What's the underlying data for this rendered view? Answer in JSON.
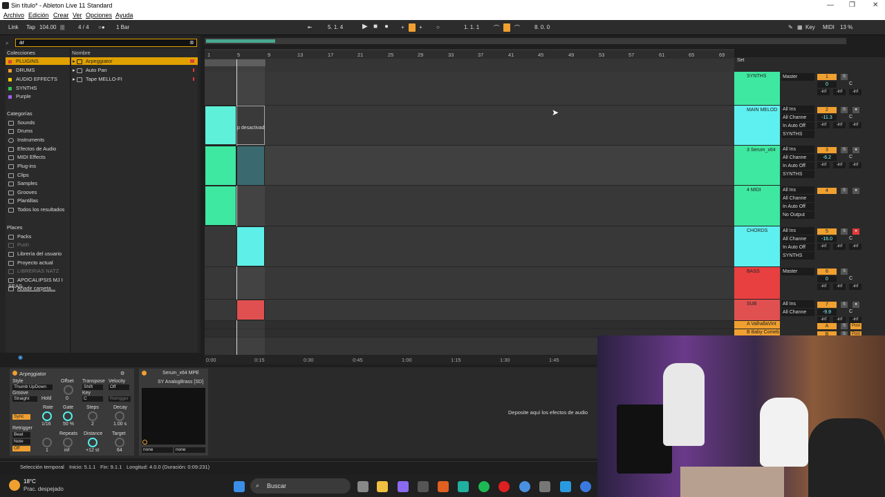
{
  "titlebar": {
    "title": "Sin título* - Ableton Live 11 Standard"
  },
  "menu": [
    "Archivo",
    "Edición",
    "Crear",
    "Ver",
    "Opciones",
    "Ayuda"
  ],
  "transport": {
    "link": "Link",
    "tap": "Tap",
    "tempo": "104.00",
    "signature": "4 / 4",
    "quantize": "1 Bar",
    "position": "5.  1.  4",
    "loop_start": "1.  1.  1",
    "loop_length": "8.  0.  0",
    "key": "Key",
    "midi": "MIDI",
    "cpu": "13 %"
  },
  "browser": {
    "search_value": "ar",
    "collections_header": "Colecciones",
    "collections": [
      {
        "label": "PLUGINS",
        "color": "#e23a3a"
      },
      {
        "label": "DRUMS",
        "color": "#f0a030"
      },
      {
        "label": "AUDIO EFFECTS",
        "color": "#f0d000"
      },
      {
        "label": "SYNTHS",
        "color": "#2ec850"
      },
      {
        "label": "Purple",
        "color": "#a060ff"
      }
    ],
    "categories_header": "Categorías",
    "categories": [
      "Sounds",
      "Drums",
      "Instruments",
      "Efectos de Audio",
      "MIDI Effects",
      "Plug-ins",
      "Clips",
      "Samples",
      "Grooves",
      "Plantillas",
      "Todos los resultados"
    ],
    "places_header": "Places",
    "places": [
      "Packs",
      "Push",
      "Librería del usuario",
      "Proyecto actual",
      "LIBRERIAS NATZ",
      "APOCALIPSIS MJ I SEAS",
      "Añadir carpeta..."
    ],
    "name_header": "Nombre",
    "results": [
      "Arpeggiator",
      "Auto Pan",
      "Tape MELLO-FI"
    ]
  },
  "ruler": [
    "1",
    "5",
    "9",
    "13",
    "17",
    "21",
    "25",
    "29",
    "33",
    "37",
    "41",
    "45",
    "49",
    "53",
    "57",
    "61",
    "65",
    "69"
  ],
  "clip_text": "p desactivad",
  "set_label": "Set",
  "tracks": [
    {
      "name": "SYNTHS",
      "color": "#3ee8a0",
      "num": "1",
      "io": [
        "Master"
      ],
      "vol": "0",
      "pan": "C"
    },
    {
      "name": "MAIN MELOD",
      "color": "#5ef0f0",
      "num": "2",
      "io": [
        "All Ins",
        "All Channe",
        "In  Auto  Off",
        "SYNTHS"
      ],
      "vol": "-11.3",
      "pan": "C"
    },
    {
      "name": "3 Serum_x64",
      "color": "#3ee8a0",
      "num": "3",
      "io": [
        "All Ins",
        "All Channe",
        "In  Auto  Off",
        "SYNTHS"
      ],
      "vol": "-6.2",
      "pan": "C"
    },
    {
      "name": "4 MIDI",
      "color": "#3ee8a0",
      "num": "4",
      "io": [
        "All Ins",
        "All Channe",
        "In  Auto  Off",
        "No Output"
      ],
      "vol": "",
      "pan": ""
    },
    {
      "name": "CHORDS",
      "color": "#5ef0f0",
      "num": "5",
      "io": [
        "All Ins",
        "All Channe",
        "In  Auto  Off",
        "SYNTHS"
      ],
      "vol": "-16.0",
      "pan": "C"
    },
    {
      "name": "BASS",
      "color": "#e84040",
      "num": "6",
      "io": [
        "Master"
      ],
      "vol": "0",
      "pan": "C"
    },
    {
      "name": "SUB",
      "color": "#e05050",
      "num": "7",
      "io": [
        "All Ins",
        "All Channe"
      ],
      "vol": "-9.9",
      "pan": "C"
    }
  ],
  "returns": [
    {
      "name": "A ValhallaVint",
      "num": "A",
      "post": "Post"
    },
    {
      "name": "B Baby Comeb",
      "num": "B",
      "post": "Post"
    }
  ],
  "inf": "-inf",
  "timeline": [
    "0:00",
    "0:15",
    "0:30",
    "0:45",
    "1:00",
    "1:15",
    "1:30",
    "1:45"
  ],
  "device": {
    "arp_title": "Arpeggiator",
    "style_label": "Style",
    "style_value": "Thumb UpDown",
    "groove_label": "Groove",
    "groove_value": "Straight",
    "hold": "Hold",
    "offset_label": "Offset",
    "offset_value": "0",
    "transpose_label": "Transpose",
    "transpose_value": "Shift",
    "key_label": "Key",
    "key_value": "C",
    "velocity_label": "Velocity",
    "velocity_value": "Off",
    "retrigger_btn": "Retrigger",
    "sync": "Sync",
    "rate_label": "Rate",
    "rate_value": "1/16",
    "gate_label": "Gate",
    "gate_value": "50 %",
    "steps_label": "Steps",
    "steps_value": "2",
    "decay_label": "Decay",
    "decay_value": "1.00 s",
    "retrigger_label": "Retrigger",
    "beat": "Beat",
    "note": "Note",
    "off": "Off",
    "retrig_knob_value": "1",
    "repeats_label": "Repeats",
    "repeats_value": "inf",
    "distance_label": "Distance",
    "distance_value": "+12 st",
    "target_label": "Target",
    "target_value": "64",
    "serum_title": "Serum_x64 MPE",
    "preset": "SY AnalogBrass [SD]",
    "none1": "none",
    "none2": "none",
    "drop_text": "Deposite aquí los efectos de audio"
  },
  "status": {
    "selection": "Selección temporal",
    "start": "Inicio: 5.1.1",
    "end": "Fin: 9.1.1",
    "length": "Longitud: 4.0.0 (Duración: 0:09:231)"
  },
  "taskbar": {
    "temp": "18°C",
    "weather": "Prac. despejado",
    "search": "Buscar"
  }
}
